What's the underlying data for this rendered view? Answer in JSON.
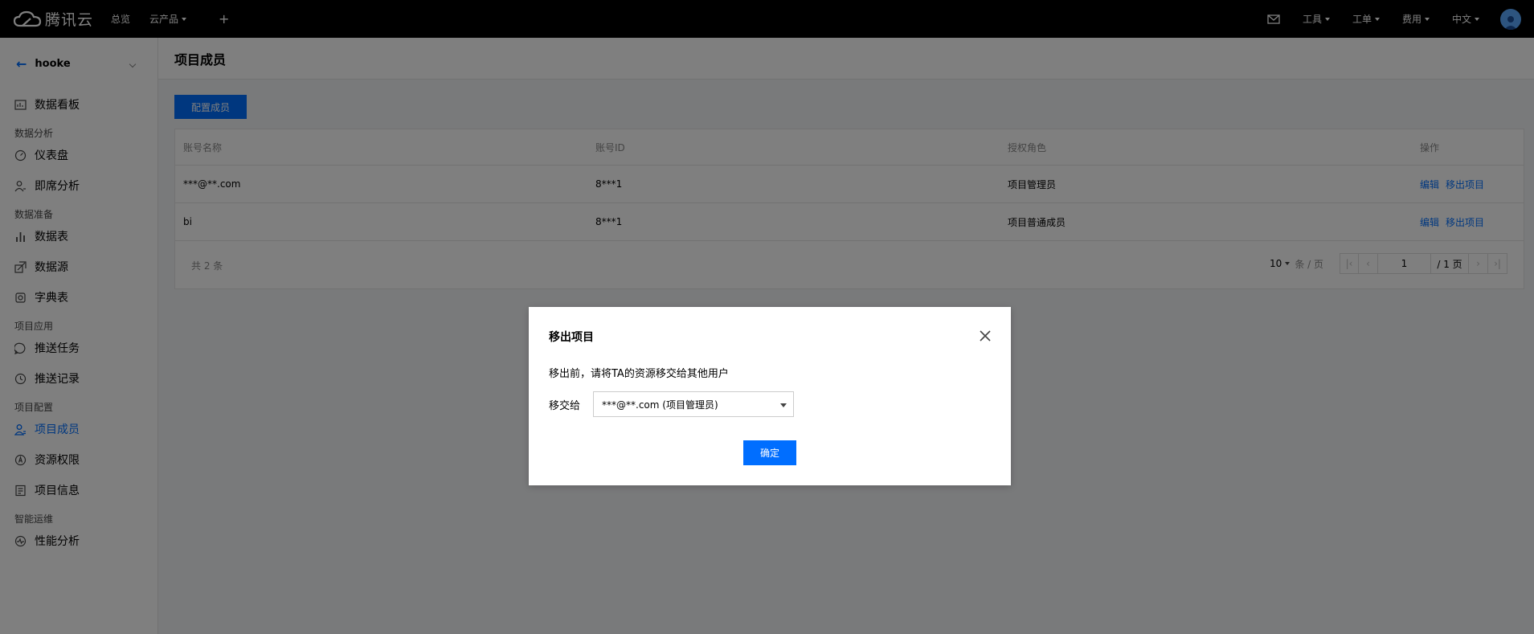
{
  "topbar": {
    "brand": "腾讯云",
    "nav": [
      "总览",
      "云产品"
    ],
    "right": [
      "工具",
      "工单",
      "费用",
      "中文"
    ]
  },
  "sidebar": {
    "project": "hooke",
    "items": [
      {
        "type": "item",
        "label": "数据看板",
        "icon": "dashboard-board-icon"
      },
      {
        "type": "group",
        "label": "数据分析"
      },
      {
        "type": "item",
        "label": "仪表盘",
        "icon": "gauge-icon"
      },
      {
        "type": "item",
        "label": "即席分析",
        "icon": "user-analysis-icon"
      },
      {
        "type": "group",
        "label": "数据准备"
      },
      {
        "type": "item",
        "label": "数据表",
        "icon": "bar-chart-icon"
      },
      {
        "type": "item",
        "label": "数据源",
        "icon": "datasource-icon"
      },
      {
        "type": "item",
        "label": "字典表",
        "icon": "dictionary-icon"
      },
      {
        "type": "group",
        "label": "项目应用"
      },
      {
        "type": "item",
        "label": "推送任务",
        "icon": "message-icon"
      },
      {
        "type": "item",
        "label": "推送记录",
        "icon": "history-icon"
      },
      {
        "type": "group",
        "label": "项目配置"
      },
      {
        "type": "item",
        "label": "项目成员",
        "icon": "member-icon",
        "active": true
      },
      {
        "type": "item",
        "label": "资源权限",
        "icon": "permission-icon"
      },
      {
        "type": "item",
        "label": "项目信息",
        "icon": "info-doc-icon"
      },
      {
        "type": "group",
        "label": "智能运维"
      },
      {
        "type": "item",
        "label": "性能分析",
        "icon": "performance-icon"
      }
    ]
  },
  "page": {
    "title": "项目成员",
    "config_button": "配置成员"
  },
  "table": {
    "columns": [
      "账号名称",
      "账号ID",
      "授权角色",
      "操作"
    ],
    "rows": [
      {
        "name": "***@**.com",
        "id": "8***1",
        "role": "项目管理员",
        "edit": "编辑",
        "remove": "移出项目"
      },
      {
        "name": "bi",
        "id": "8***1",
        "role": "项目普通成员",
        "edit": "编辑",
        "remove": "移出项目"
      }
    ],
    "total": "共 2 条",
    "page_size": "10",
    "page_size_unit": "条 / 页",
    "page_current": "1",
    "page_total": "/ 1 页"
  },
  "dialog": {
    "title": "移出项目",
    "message": "移出前，请将TA的资源移交给其他用户",
    "transfer_label": "移交给",
    "transfer_value": "***@**.com (项目管理员)",
    "ok": "确定"
  },
  "colors": {
    "accent": "#006eff",
    "topbar": "#000000"
  }
}
